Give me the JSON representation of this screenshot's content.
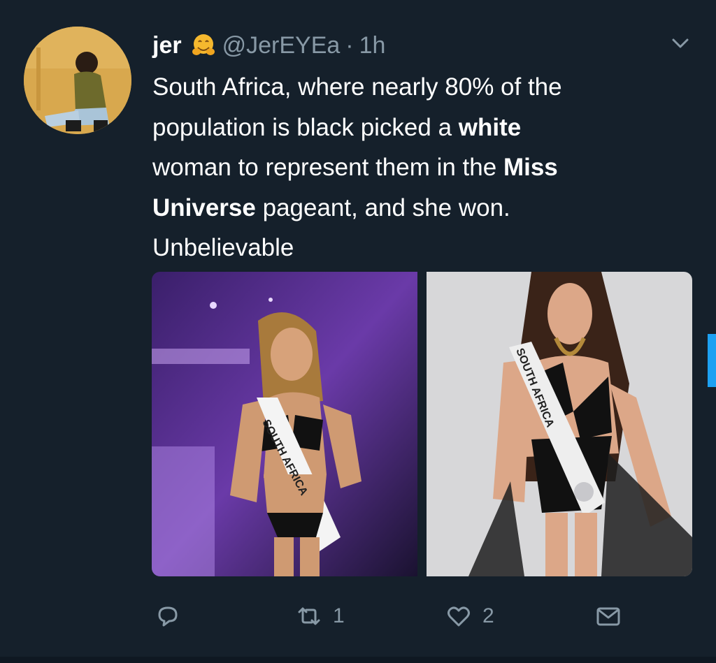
{
  "tweet": {
    "author": {
      "name": "jer",
      "emoji_icon": "hugging-face-emoji-icon",
      "handle": "@JerEYEa",
      "separator": "·",
      "time": "1h"
    },
    "text": {
      "line1": "South Africa, where nearly 80% of the",
      "line2_a": "population is black picked a ",
      "line2_b": "white",
      "line3_a": "woman to represent them in the ",
      "line3_b": "Miss",
      "line4_a": "Universe",
      "line4_b": " pageant, and she won.",
      "line5": "Unbelievable"
    },
    "media": [
      {
        "icon": "photo-pageant-contestant-stage",
        "sash_text": "SOUTH AFRICA"
      },
      {
        "icon": "photo-pageant-contestant-studio",
        "sash_text": "SOUTH AFRICA"
      }
    ],
    "actions": {
      "reply_icon": "reply-icon",
      "retweet_icon": "retweet-icon",
      "retweet_count": "1",
      "like_icon": "heart-icon",
      "like_count": "2",
      "dm_icon": "envelope-icon"
    },
    "colors": {
      "background": "#15202b",
      "text": "#ffffff",
      "muted": "#8899a6",
      "accent": "#1da1f2"
    }
  }
}
